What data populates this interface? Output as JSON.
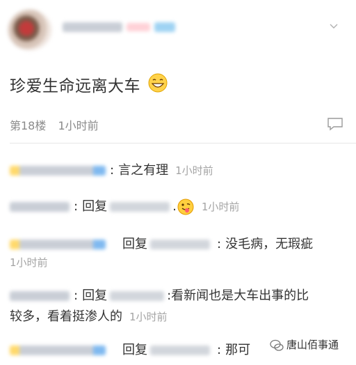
{
  "post": {
    "content": "珍爱生命远离大车",
    "floor": "第18楼",
    "time": "1小时前"
  },
  "replies": [
    {
      "text": "言之有理",
      "time": "1小时前"
    },
    {
      "reply_label": "回复",
      "time": "1小时前"
    },
    {
      "reply_label": "回复",
      "text": "没毛病，无瑕疵",
      "time": "1小时前"
    },
    {
      "reply_label": "回复",
      "text_line1": ":看新闻也是大车出事的比",
      "text_line2": "较多，看着挺渗人的",
      "time": "1小时前"
    },
    {
      "reply_label": "回复",
      "text": "那可"
    }
  ],
  "watermark": {
    "text": "唐山佰事通"
  }
}
